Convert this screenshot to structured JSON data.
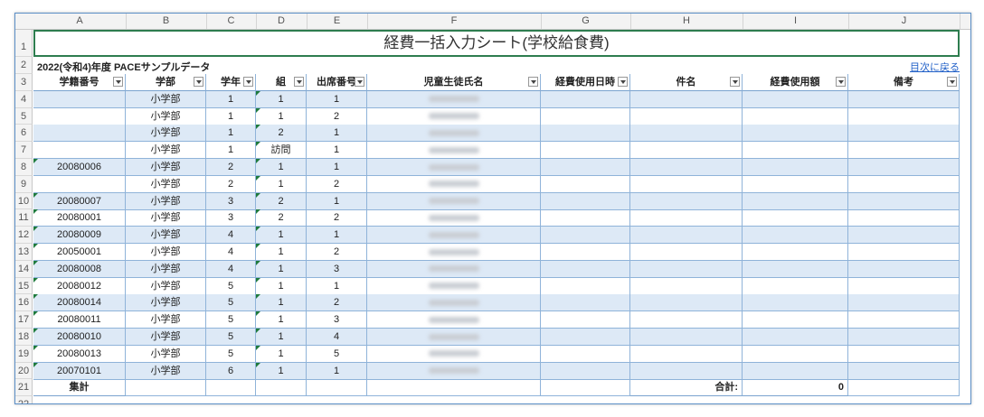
{
  "sheet": {
    "columns": [
      "A",
      "B",
      "C",
      "D",
      "E",
      "F",
      "G",
      "H",
      "I",
      "J"
    ],
    "row_numbers": [
      "1",
      "2",
      "3",
      "4",
      "5",
      "6",
      "7",
      "8",
      "9",
      "10",
      "11",
      "12",
      "13",
      "14",
      "15",
      "16",
      "17",
      "18",
      "19",
      "20",
      "21",
      "22"
    ],
    "title": "経費一括入力シート(学校給食費)",
    "subtitle": "2022(令和4)年度  PACEサンプルデータ",
    "toc_link": "目次に戻る",
    "headers": [
      "学籍番号",
      "学部",
      "学年",
      "組",
      "出席番号",
      "児童生徒氏名",
      "経費使用日時",
      "件名",
      "経費使用額",
      "備考"
    ],
    "rows": [
      {
        "id": "",
        "dept": "小学部",
        "grade": "1",
        "cls": "1",
        "num": "1"
      },
      {
        "id": "",
        "dept": "小学部",
        "grade": "1",
        "cls": "1",
        "num": "2"
      },
      {
        "id": "",
        "dept": "小学部",
        "grade": "1",
        "cls": "2",
        "num": "1"
      },
      {
        "id": "",
        "dept": "小学部",
        "grade": "1",
        "cls": "訪問",
        "num": "1"
      },
      {
        "id": "20080006",
        "dept": "小学部",
        "grade": "2",
        "cls": "1",
        "num": "1"
      },
      {
        "id": "",
        "dept": "小学部",
        "grade": "2",
        "cls": "1",
        "num": "2"
      },
      {
        "id": "20080007",
        "dept": "小学部",
        "grade": "3",
        "cls": "2",
        "num": "1"
      },
      {
        "id": "20080001",
        "dept": "小学部",
        "grade": "3",
        "cls": "2",
        "num": "2"
      },
      {
        "id": "20080009",
        "dept": "小学部",
        "grade": "4",
        "cls": "1",
        "num": "1"
      },
      {
        "id": "20050001",
        "dept": "小学部",
        "grade": "4",
        "cls": "1",
        "num": "2"
      },
      {
        "id": "20080008",
        "dept": "小学部",
        "grade": "4",
        "cls": "1",
        "num": "3"
      },
      {
        "id": "20080012",
        "dept": "小学部",
        "grade": "5",
        "cls": "1",
        "num": "1"
      },
      {
        "id": "20080014",
        "dept": "小学部",
        "grade": "5",
        "cls": "1",
        "num": "2"
      },
      {
        "id": "20080011",
        "dept": "小学部",
        "grade": "5",
        "cls": "1",
        "num": "3"
      },
      {
        "id": "20080010",
        "dept": "小学部",
        "grade": "5",
        "cls": "1",
        "num": "4"
      },
      {
        "id": "20080013",
        "dept": "小学部",
        "grade": "5",
        "cls": "1",
        "num": "5"
      },
      {
        "id": "20070101",
        "dept": "小学部",
        "grade": "6",
        "cls": "1",
        "num": "1"
      }
    ],
    "footer": {
      "label": "集計",
      "total_label": "合計:",
      "total_value": "0"
    }
  }
}
